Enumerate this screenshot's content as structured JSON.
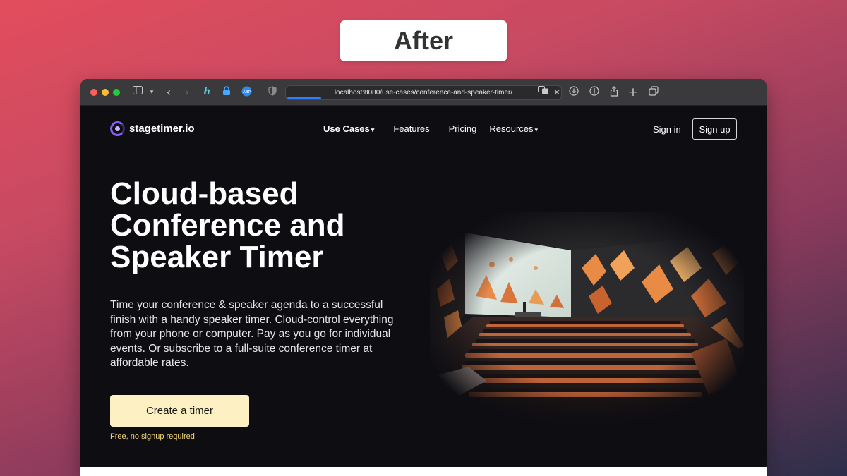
{
  "badge": {
    "label": "After"
  },
  "browser": {
    "url": "localhost:8080/use-cases/conference-and-speaker-timer/",
    "icons": [
      "sidebar-icon",
      "chevron-down-icon",
      "back-icon",
      "forward-icon",
      "honey-extension-icon",
      "lock-extension-icon",
      "adblock-extension-icon",
      "shield-icon",
      "translate-icon",
      "close-icon",
      "download-icon",
      "info-icon",
      "share-icon",
      "plus-icon",
      "tabs-icon"
    ]
  },
  "nav": {
    "logo_text": "stagetimer.io",
    "links": [
      {
        "label": "Use Cases",
        "dropdown": true
      },
      {
        "label": "Features",
        "dropdown": false
      },
      {
        "label": "Pricing",
        "dropdown": false
      },
      {
        "label": "Resources",
        "dropdown": true
      }
    ],
    "signin": "Sign in",
    "signup": "Sign up"
  },
  "hero": {
    "title": "Cloud-based Conference and Speaker Timer",
    "description": "Time your conference & speaker agenda to a successful finish with a handy speaker timer. Cloud-control everything from your phone or computer. Pay as you go for individual events. Or subscribe to a full-suite conference timer at affordable rates.",
    "cta": "Create a timer",
    "cta_note": "Free, no signup required"
  },
  "colors": {
    "background_start": "#e24d5d",
    "site_bg": "#0d0d12",
    "cta_bg": "#fdf0c2",
    "cta_note": "#f5d77a",
    "logo_purple": "#8b5cf6"
  }
}
